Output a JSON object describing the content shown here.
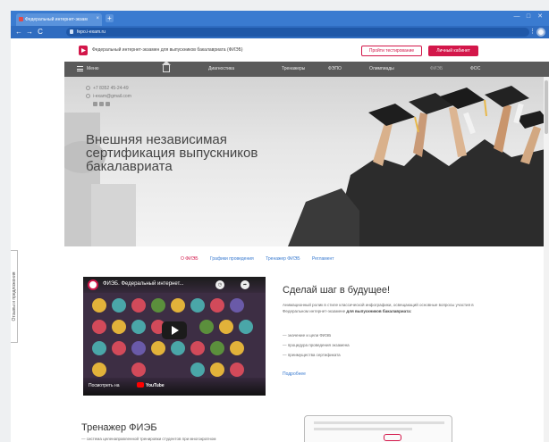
{
  "browser": {
    "tab_title": "Федеральный интернет-экзам",
    "url": "fepo.i-exam.ru",
    "new_tab": "+",
    "close": "×",
    "back": "←",
    "forward": "→",
    "reload": "C",
    "minimize": "—",
    "maximize": "□",
    "win_close": "✕",
    "menu": "⋮"
  },
  "site": {
    "name": "Федеральный интернет-экзамен для выпускников бакалавриата (ФИЭБ)",
    "btn_register": "Пройти тестирование",
    "btn_cabinet": "Личный кабинет"
  },
  "nav": {
    "menu": "Меню",
    "items": [
      "Диагностика",
      "Тренажеры",
      "ФЭПО",
      "Олимпиады",
      "ФИЭБ",
      "ФОС"
    ]
  },
  "hero": {
    "phone": "+7 8352 45-24-49",
    "email": "i-exam@gmail.com",
    "title": "Внешняя независимая сертификация выпускников бакалавриата"
  },
  "sidetab": {
    "label": "Отзывы и предложения"
  },
  "links": [
    "О ФИЭБ",
    "Графики проведения",
    "Тренажер ФИЭБ",
    "Регламент"
  ],
  "video": {
    "title": "ФИЭБ. Федеральный интернет...",
    "watch": "Посмотреть на",
    "brand": "YouTube"
  },
  "step": {
    "title": "Сделай шаг в будущее!",
    "desc": "Анимационный ролик в стиле классической инфографики, освещающий основные вопросы участия в Федеральном интернет-экзамене",
    "desc_bold": "для выпускников бакалавриата:",
    "bullets": [
      "значение и цели ФИЭБ",
      "процедура проведения экзамена",
      "преимущества сертификата"
    ],
    "more": "Подробнее"
  },
  "trainer": {
    "title": "Тренажер ФИЭБ",
    "desc": "— система целенаправленной тренировки студентов при многократном"
  },
  "colors": {
    "brand_red": "#d3174a",
    "nav_bg": "#5a5a5a",
    "chrome_blue": "#3a7bd0",
    "link_blue": "#3a7bd0"
  }
}
